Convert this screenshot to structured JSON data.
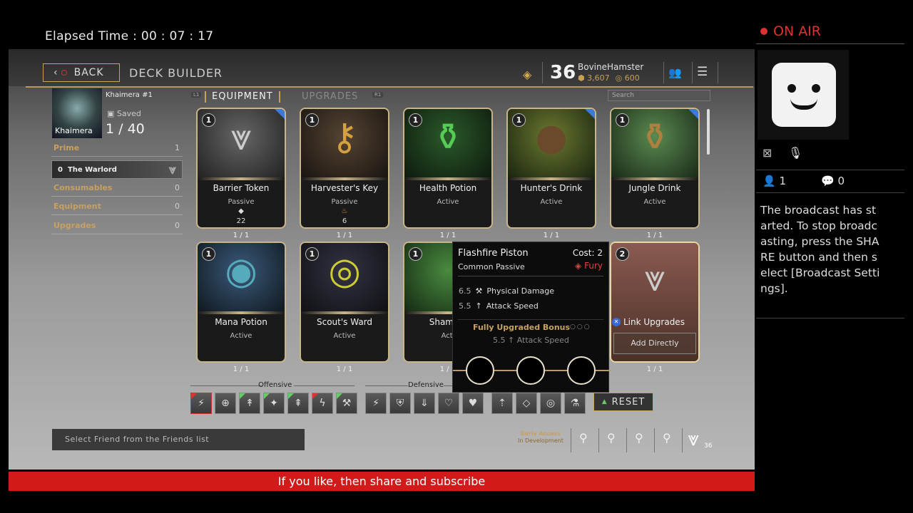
{
  "stream": {
    "elapsed_label": "Elapsed Time : 00 : 07 : 17",
    "on_air": "ON AIR",
    "viewers": "1",
    "comments": "0",
    "message": "The broadcast has started. To stop broadcasting, press the SHARE button and then select [Broadcast Settings].",
    "banner": "If you like, then share and subscribe"
  },
  "header": {
    "back_label": "BACK",
    "title": "DECK BUILDER",
    "level": "36",
    "username": "BovineHamster",
    "currency1": "3,607",
    "currency2": "600"
  },
  "deck": {
    "hero": "Khaimera",
    "name": "Khaimera #1",
    "saved": "Saved",
    "count": "1 / 40",
    "categories": [
      {
        "label": "Prime",
        "count": "1"
      },
      {
        "label": "Consumables",
        "count": "0"
      },
      {
        "label": "Equipment",
        "count": "0"
      },
      {
        "label": "Upgrades",
        "count": "0"
      }
    ],
    "prime_card": {
      "count": "0",
      "label": "The Warlord"
    }
  },
  "tabs": {
    "equipment": "EQUIPMENT",
    "upgrades": "UPGRADES",
    "hint_left": "L1",
    "hint_right": "R1",
    "search_placeholder": "Search"
  },
  "cards": [
    {
      "name": "Barrier Token",
      "type": "Passive",
      "cost": "1",
      "value": "22",
      "qty": "1 / 1"
    },
    {
      "name": "Harvester's Key",
      "type": "Passive",
      "cost": "1",
      "value": "6",
      "qty": "1 / 1"
    },
    {
      "name": "Health Potion",
      "type": "Active",
      "cost": "1",
      "value": "",
      "qty": "1 / 1"
    },
    {
      "name": "Hunter's Drink",
      "type": "Active",
      "cost": "1",
      "value": "",
      "qty": "1 / 1"
    },
    {
      "name": "Jungle Drink",
      "type": "Active",
      "cost": "1",
      "value": "",
      "qty": "1 / 1"
    },
    {
      "name": "Mana Potion",
      "type": "Active",
      "cost": "1",
      "value": "",
      "qty": "1 / 1"
    },
    {
      "name": "Scout's Ward",
      "type": "Active",
      "cost": "1",
      "value": "",
      "qty": "1 / 1"
    },
    {
      "name": "Shaman'",
      "type": "Acti",
      "cost": "1",
      "value": "",
      "qty": "1 / 1"
    },
    {
      "name": "",
      "type": "",
      "cost": "2",
      "value": "",
      "qty": "1 / 1"
    }
  ],
  "tooltip": {
    "name": "Flashfire Piston",
    "cost": "Cost: 2",
    "rarity": "Common Passive",
    "affinity": "Fury",
    "stat1_value": "6.5",
    "stat1_label": "Physical Damage",
    "stat2_value": "5.5",
    "stat2_label": "Attack Speed",
    "bonus_title": "Fully Upgraded Bonus",
    "bonus_value": "5.5",
    "bonus_label": "Attack Speed"
  },
  "card_actions": {
    "link": "Link Upgrades",
    "add": "Add Directly"
  },
  "filters": {
    "offensive": "Offensive",
    "defensive": "Defensive",
    "reset": "RESET"
  },
  "bottom": {
    "friend_placeholder": "Select Friend from the Friends list",
    "early_line1": "Early Access",
    "early_line2": "In Development",
    "crest_level": "36"
  }
}
